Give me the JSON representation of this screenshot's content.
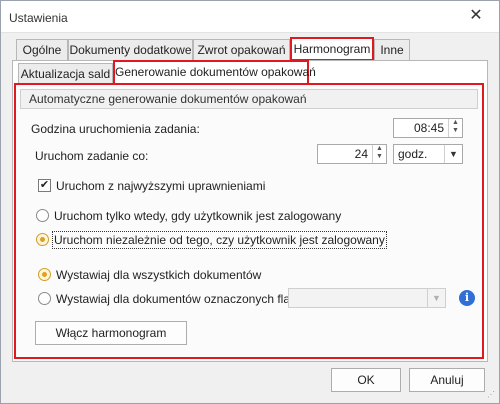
{
  "window": {
    "title": "Ustawienia",
    "close_glyph": "✕"
  },
  "tabs_top": [
    {
      "label": "Ogólne"
    },
    {
      "label": "Dokumenty dodatkowe"
    },
    {
      "label": "Zwrot opakowań"
    },
    {
      "label": "Harmonogram",
      "selected": true
    },
    {
      "label": "Inne"
    }
  ],
  "tabs_sub": [
    {
      "label": "Aktualizacja sald"
    },
    {
      "label": "Generowanie dokumentów opakowań",
      "selected": true
    }
  ],
  "group": {
    "header": "Automatyczne generowanie dokumentów opakowań",
    "start_time_label": "Godzina uruchomienia zadania:",
    "start_time_value": "08:45",
    "run_every_label": "Uruchom zadanie co:",
    "run_every_value": "24",
    "run_every_unit": "godz.",
    "highest_priv_label": "Uruchom z najwyższymi uprawnieniami",
    "highest_priv_checked": true,
    "run_options": [
      {
        "label": "Uruchom tylko wtedy, gdy użytkownik jest zalogowany",
        "checked": false
      },
      {
        "label": "Uruchom niezależnie od tego, czy użytkownik jest zalogowany",
        "checked": true
      }
    ],
    "issue_options": [
      {
        "label": "Wystawiaj dla wszystkich dokumentów",
        "checked": true
      },
      {
        "label": "Wystawiaj dla dokumentów oznaczonych flagą",
        "checked": false
      }
    ],
    "flag_combo_value": "",
    "enable_button": "Włącz harmonogram"
  },
  "footer": {
    "ok": "OK",
    "cancel": "Anuluj"
  },
  "icons": {
    "spin_up": "▲",
    "spin_down": "▼",
    "dropdown": "▼",
    "check": "✔",
    "info": "i",
    "grip": "⋰"
  },
  "colors": {
    "highlight": "#e0191f",
    "radio_selected": "#e0a020",
    "info_icon": "#2f6fd6"
  }
}
